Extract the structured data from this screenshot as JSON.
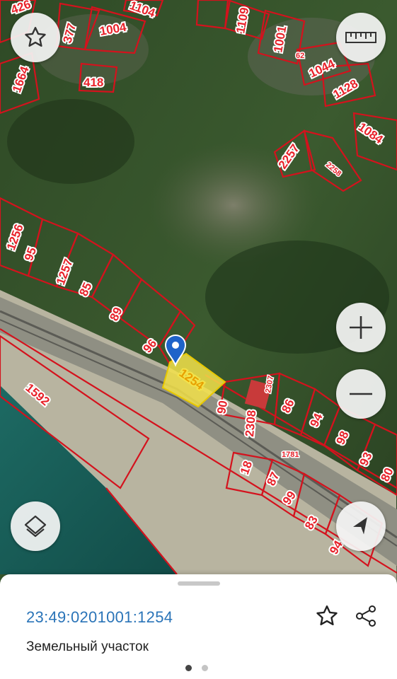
{
  "map": {
    "plots": [
      {
        "label": "426"
      },
      {
        "label": "377"
      },
      {
        "label": "1004"
      },
      {
        "label": "1104"
      },
      {
        "label": "1109"
      },
      {
        "label": "1001"
      },
      {
        "label": "1664"
      },
      {
        "label": "418"
      },
      {
        "label": "62"
      },
      {
        "label": "1044"
      },
      {
        "label": "1128"
      },
      {
        "label": "1084"
      },
      {
        "label": "2257"
      },
      {
        "label": "2258"
      },
      {
        "label": "1256"
      },
      {
        "label": "95"
      },
      {
        "label": "1257"
      },
      {
        "label": "85"
      },
      {
        "label": "89"
      },
      {
        "label": "96"
      },
      {
        "label": "1254"
      },
      {
        "label": "2307"
      },
      {
        "label": "90"
      },
      {
        "label": "2308"
      },
      {
        "label": "86"
      },
      {
        "label": "94"
      },
      {
        "label": "98"
      },
      {
        "label": "93"
      },
      {
        "label": "1781"
      },
      {
        "label": "80"
      },
      {
        "label": "1592"
      },
      {
        "label": "18"
      },
      {
        "label": "87"
      },
      {
        "label": "99"
      },
      {
        "label": "83"
      },
      {
        "label": "94"
      }
    ]
  },
  "controls": {
    "favorite": "star-icon",
    "ruler": "ruler-icon",
    "zoom_in": "plus-icon",
    "zoom_out": "minus-icon",
    "layers": "layers-icon",
    "locate": "navigation-arrow-icon"
  },
  "selected": {
    "cadastral_number": "23:49:0201001:1254",
    "type": "Земельный участок"
  },
  "pager": {
    "pages": 2,
    "active": 1
  },
  "colors": {
    "parcel": "#d4121d",
    "selected_fill": "#f3e24a",
    "link": "#2a74b8",
    "pin": "#1f63c9"
  }
}
